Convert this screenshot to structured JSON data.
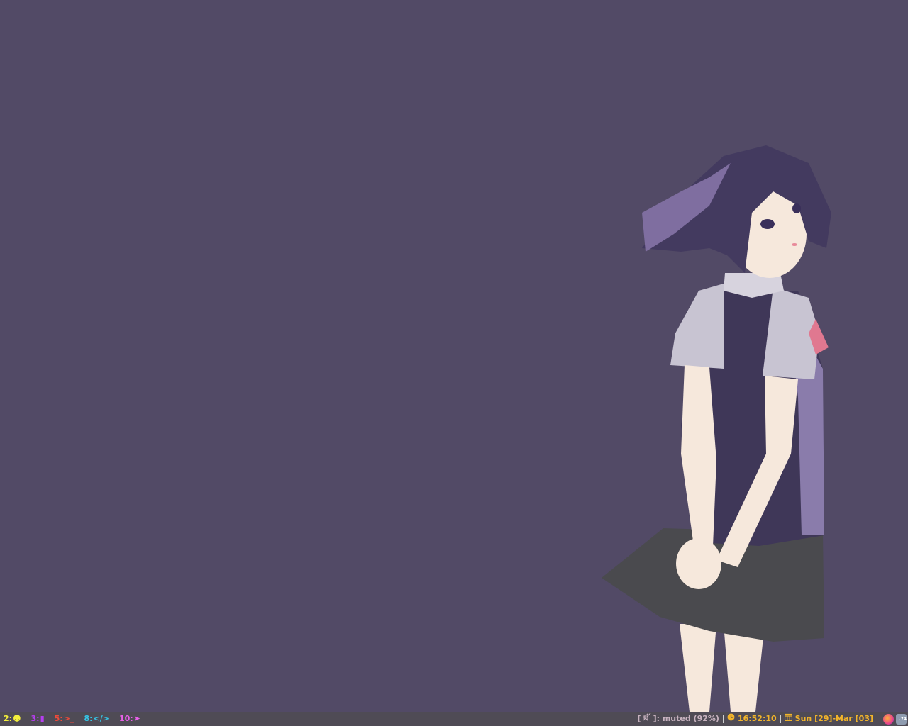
{
  "workspaces": [
    {
      "num": "2:",
      "glyph": "☻",
      "icon": "smiley-icon",
      "color": "#f5f03c"
    },
    {
      "num": "3:",
      "glyph": "▮",
      "icon": "file-icon",
      "color": "#b63ef0"
    },
    {
      "num": "5:",
      "glyph": ">_",
      "icon": "terminal-icon",
      "color": "#ef4a3a"
    },
    {
      "num": "8:",
      "glyph": "</>",
      "icon": "code-icon",
      "color": "#35c6e8"
    },
    {
      "num": "10:",
      "glyph": "➤",
      "icon": "send-icon",
      "color": "#e860e8"
    }
  ],
  "status": {
    "volume": {
      "open": "[",
      "close": "]",
      "text": ": muted (92%)",
      "icon": "muted-speaker-icon",
      "color": "#c7b2bf"
    },
    "clock": {
      "text": "16:52:10",
      "icon": "clock-icon",
      "color": "#f2b42a"
    },
    "date": {
      "text": "Sun [29]-Mar [03]",
      "icon": "calendar-icon",
      "color": "#f2b42a"
    }
  },
  "tray": [
    {
      "icon": "firefox-icon",
      "color": "#e8458a"
    },
    {
      "icon": "weather-icon",
      "label": ".74",
      "color": "#8f9cb0"
    }
  ]
}
